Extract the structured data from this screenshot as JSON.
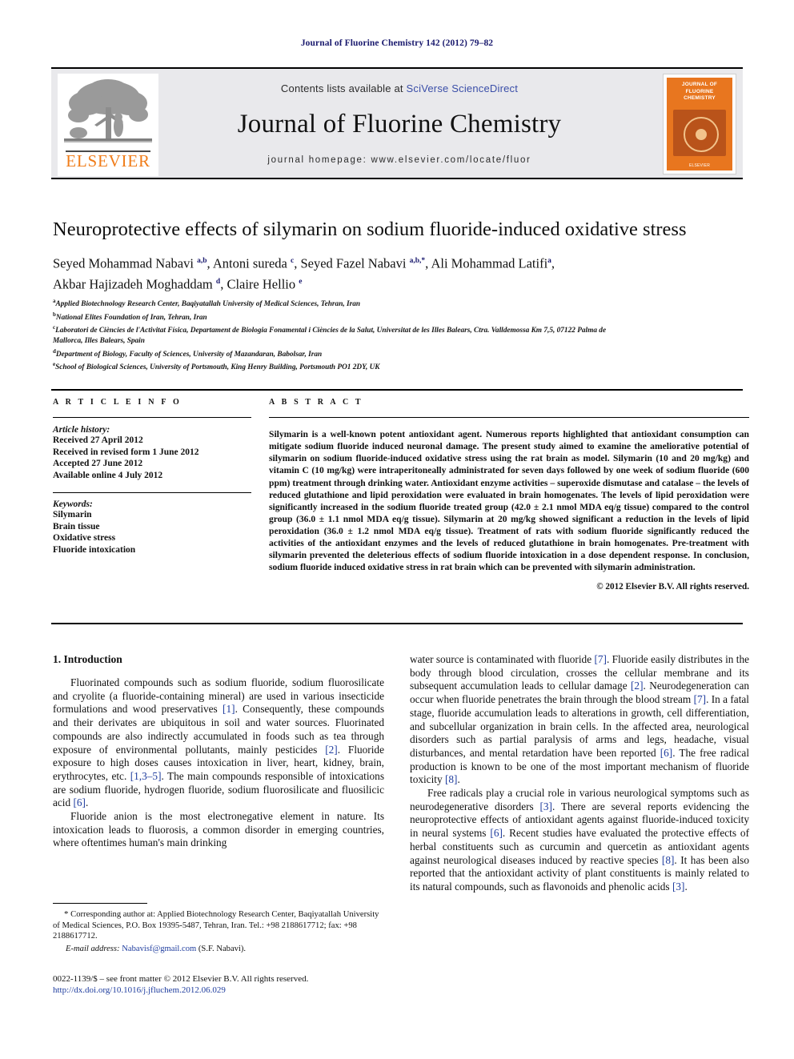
{
  "running_head": "Journal of Fluorine Chemistry 142 (2012) 79–82",
  "masthead": {
    "contents_prefix": "Contents lists available at ",
    "sciencedirect": "SciVerse ScienceDirect",
    "journal_title": "Journal of Fluorine Chemistry",
    "homepage": "journal homepage: www.elsevier.com/locate/fluor",
    "publisher_logo_text": "ELSEVIER",
    "cover": {
      "title_line1": "JOURNAL OF",
      "title_line2": "FLUORINE",
      "title_line3": "CHEMISTRY",
      "footer": "ELSEVIER"
    }
  },
  "article": {
    "title": "Neuroprotective effects of silymarin on sodium fluoride-induced oxidative stress",
    "authors_line1_a": "Seyed Mohammad Nabavi ",
    "authors_line1_a_sup": "a,b",
    "authors_line1_b": ", Antoni sureda ",
    "authors_line1_b_sup": "c",
    "authors_line1_c": ", Seyed Fazel Nabavi ",
    "authors_line1_c_sup": "a,b,*",
    "authors_line1_d": ", Ali Mohammad Latifi",
    "authors_line1_d_sup": "a",
    "authors_line1_e": ",",
    "authors_line2_a": "Akbar Hajizadeh Moghaddam ",
    "authors_line2_a_sup": "d",
    "authors_line2_b": ", Claire Hellio ",
    "authors_line2_b_sup": "e",
    "affiliations": [
      {
        "mark": "a",
        "text": "Applied Biotechnology Research Center, Baqiyatallah University of Medical Sciences, Tehran, Iran"
      },
      {
        "mark": "b",
        "text": "National Elites Foundation of Iran, Tehran, Iran"
      },
      {
        "mark": "c",
        "text": "Laboratori de Ciències de l'Activitat Física, Departament de Biologia Fonamental i Ciències de la Salut, Universitat de les Illes Balears, Ctra. Valldemossa Km 7,5, 07122 Palma de Mallorca, Illes Balears, Spain"
      },
      {
        "mark": "d",
        "text": "Department of Biology, Faculty of Sciences, University of Mazandaran, Babolsar, Iran"
      },
      {
        "mark": "e",
        "text": "School of Biological Sciences, University of Portsmouth, King Henry Building, Portsmouth PO1 2DY, UK"
      }
    ]
  },
  "article_info": {
    "heading": "A R T I C L E   I N F O",
    "history_label": "Article history:",
    "history": [
      "Received 27 April 2012",
      "Received in revised form 1 June 2012",
      "Accepted 27 June 2012",
      "Available online 4 July 2012"
    ],
    "keywords_label": "Keywords:",
    "keywords": [
      "Silymarin",
      "Brain tissue",
      "Oxidative stress",
      "Fluoride intoxication"
    ]
  },
  "abstract": {
    "heading": "A B S T R A C T",
    "text": "Silymarin is a well-known potent antioxidant agent. Numerous reports highlighted that antioxidant consumption can mitigate sodium fluoride induced neuronal damage. The present study aimed to examine the ameliorative potential of silymarin on sodium fluoride-induced oxidative stress using the rat brain as model. Silymarin (10 and 20 mg/kg) and vitamin C (10 mg/kg) were intraperitoneally administrated for seven days followed by one week of sodium fluoride (600 ppm) treatment through drinking water. Antioxidant enzyme activities – superoxide dismutase and catalase – the levels of reduced glutathione and lipid peroxidation were evaluated in brain homogenates. The levels of lipid peroxidation were significantly increased in the sodium fluoride treated group (42.0 ± 2.1 nmol MDA eq/g tissue) compared to the control group (36.0 ± 1.1 nmol MDA eq/g tissue). Silymarin at 20 mg/kg showed significant a reduction in the levels of lipid peroxidation (36.0 ± 1.2 nmol MDA eq/g tissue). Treatment of rats with sodium fluoride significantly reduced the activities of the antioxidant enzymes and the levels of reduced glutathione in brain homogenates. Pre-treatment with silymarin prevented the deleterious effects of sodium fluoride intoxication in a dose dependent response. In conclusion, sodium fluoride induced oxidative stress in rat brain which can be prevented with silymarin administration.",
    "copyright": "© 2012 Elsevier B.V. All rights reserved."
  },
  "body": {
    "section_heading": "1. Introduction",
    "left_paragraphs": [
      "Fluorinated compounds such as sodium fluoride, sodium fluorosilicate and cryolite (a fluoride-containing mineral) are used in various insecticide formulations and wood preservatives [1]. Consequently, these compounds and their derivates are ubiquitous in soil and water sources. Fluorinated compounds are also indirectly accumulated in foods such as tea through exposure of environmental pollutants, mainly pesticides [2]. Fluoride exposure to high doses causes intoxication in liver, heart, kidney, brain, erythrocytes, etc. [1,3–5]. The main compounds responsible of intoxications are sodium fluoride, hydrogen fluoride, sodium fluorosilicate and fluosilicic acid [6].",
      "Fluoride anion is the most electronegative element in nature. Its intoxication leads to fluorosis, a common disorder in emerging countries, where oftentimes human's main drinking"
    ],
    "right_paragraphs": [
      "water source is contaminated with fluoride [7]. Fluoride easily distributes in the body through blood circulation, crosses the cellular membrane and its subsequent accumulation leads to cellular damage [2]. Neurodegeneration can occur when fluoride penetrates the brain through the blood stream [7]. In a fatal stage, fluoride accumulation leads to alterations in growth, cell differentiation, and subcellular organization in brain cells. In the affected area, neurological disorders such as partial paralysis of arms and legs, headache, visual disturbances, and mental retardation have been reported [6]. The free radical production is known to be one of the most important mechanism of fluoride toxicity [8].",
      "Free radicals play a crucial role in various neurological symptoms such as neurodegenerative disorders [3]. There are several reports evidencing the neuroprotective effects of antioxidant agents against fluoride-induced toxicity in neural systems [6]. Recent studies have evaluated the protective effects of herbal constituents such as curcumin and quercetin as antioxidant agents against neurological diseases induced by reactive species [8]. It has been also reported that the antioxidant activity of plant constituents is mainly related to its natural compounds, such as flavonoids and phenolic acids [3]."
    ]
  },
  "footnote": {
    "star": "*",
    "line1": "Corresponding author at: Applied Biotechnology Research Center, Baqiyatallah",
    "line2": "University of Medical Sciences, P.O. Box 19395-5487, Tehran, Iran.",
    "line3": "Tel.: +98 2188617712; fax: +98 2188617712.",
    "email_label": "E-mail address:",
    "email": "Nabavisf@gmail.com",
    "email_owner": "(S.F. Nabavi)."
  },
  "bottom": {
    "issn": "0022-1139/$ – see front matter © 2012 Elsevier B.V. All rights reserved.",
    "doi": "http://dx.doi.org/10.1016/j.jfluchem.2012.06.029"
  },
  "colors": {
    "link_blue": "#1f3d9e",
    "elsevier_orange": "#f07d1a",
    "masthead_grey": "#e9e9ec"
  }
}
